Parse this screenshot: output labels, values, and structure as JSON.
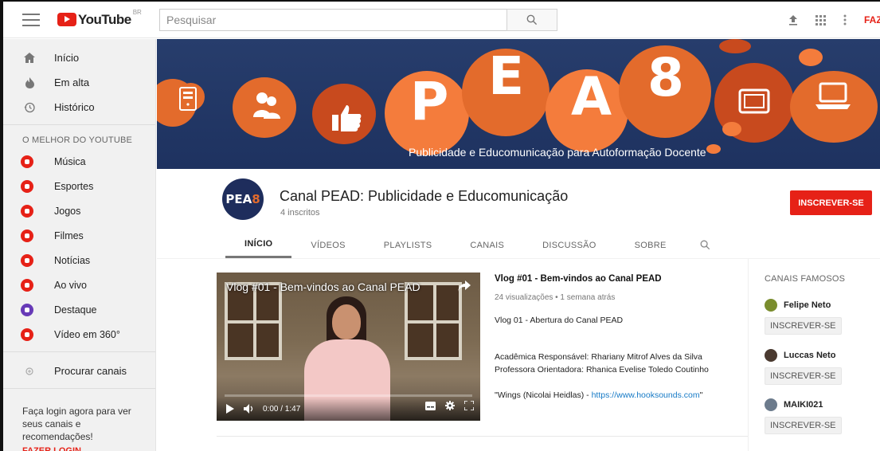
{
  "topbar": {
    "region": "BR",
    "logo_text": "YouTube",
    "search_placeholder": "Pesquisar",
    "signin_label": "FAZER LOGIN"
  },
  "sidebar": {
    "main_items": [
      {
        "label": "Início",
        "icon": "home-icon"
      },
      {
        "label": "Em alta",
        "icon": "trending-icon"
      },
      {
        "label": "Histórico",
        "icon": "history-icon"
      }
    ],
    "section_title": "O MELHOR DO YOUTUBE",
    "categories": [
      {
        "label": "Música",
        "color": "#e62117"
      },
      {
        "label": "Esportes",
        "color": "#e62117"
      },
      {
        "label": "Jogos",
        "color": "#e62117"
      },
      {
        "label": "Filmes",
        "color": "#e62117"
      },
      {
        "label": "Notícias",
        "color": "#e62117"
      },
      {
        "label": "Ao vivo",
        "color": "#e62117"
      },
      {
        "label": "Destaque",
        "color": "#673ab7"
      },
      {
        "label": "Vídeo em 360°",
        "color": "#e62117"
      }
    ],
    "browse_channels": "Procurar canais",
    "login_message": "Faça login agora para ver seus canais e recomendações!",
    "login_link": "FAZER LOGIN"
  },
  "banner": {
    "letters": [
      "P",
      "E",
      "A",
      "8"
    ],
    "subtitle": "Publicidade e Educomunicação para Autoformação Docente"
  },
  "channel": {
    "avatar_text": "PEA",
    "avatar_accent": "8",
    "title": "Canal PEAD: Publicidade e Educomunicação",
    "subscribers": "4 inscritos",
    "subscribe_label": "INSCREVER-SE",
    "tabs": [
      "INÍCIO",
      "VÍDEOS",
      "PLAYLISTS",
      "CANAIS",
      "DISCUSSÃO",
      "SOBRE"
    ],
    "active_tab": "INÍCIO"
  },
  "featured_video": {
    "player_title": "Vlog #01 - Bem-vindos ao Canal PEAD",
    "time": "0:00 / 1:47",
    "progress": 0,
    "title": "Vlog #01 - Bem-vindos ao Canal PEAD",
    "meta": "24 visualizações • 1 semana atrás",
    "desc_line1": "Vlog 01 - Abertura do Canal PEAD",
    "desc_line2": "Acadêmica Responsável: Rhariany Mitrof Alves da Silva",
    "desc_line3": "Professora Orientadora: Rhanica Evelise Toledo Coutinho",
    "desc_line4": "\"Wings (Nicolai Heidlas) - ",
    "desc_link": "https://www.hooksounds.com",
    "desc_end": "\""
  },
  "right_column": {
    "title": "CANAIS FAMOSOS",
    "channels": [
      {
        "name": "Felipe Neto",
        "button": "INSCREVER-SE",
        "color": "#7a8d2e"
      },
      {
        "name": "Luccas Neto",
        "button": "INSCREVER-SE",
        "color": "#4a3a30"
      },
      {
        "name": "MAIKI021",
        "button": "INSCREVER-SE",
        "color": "#6c7b8c"
      }
    ]
  }
}
